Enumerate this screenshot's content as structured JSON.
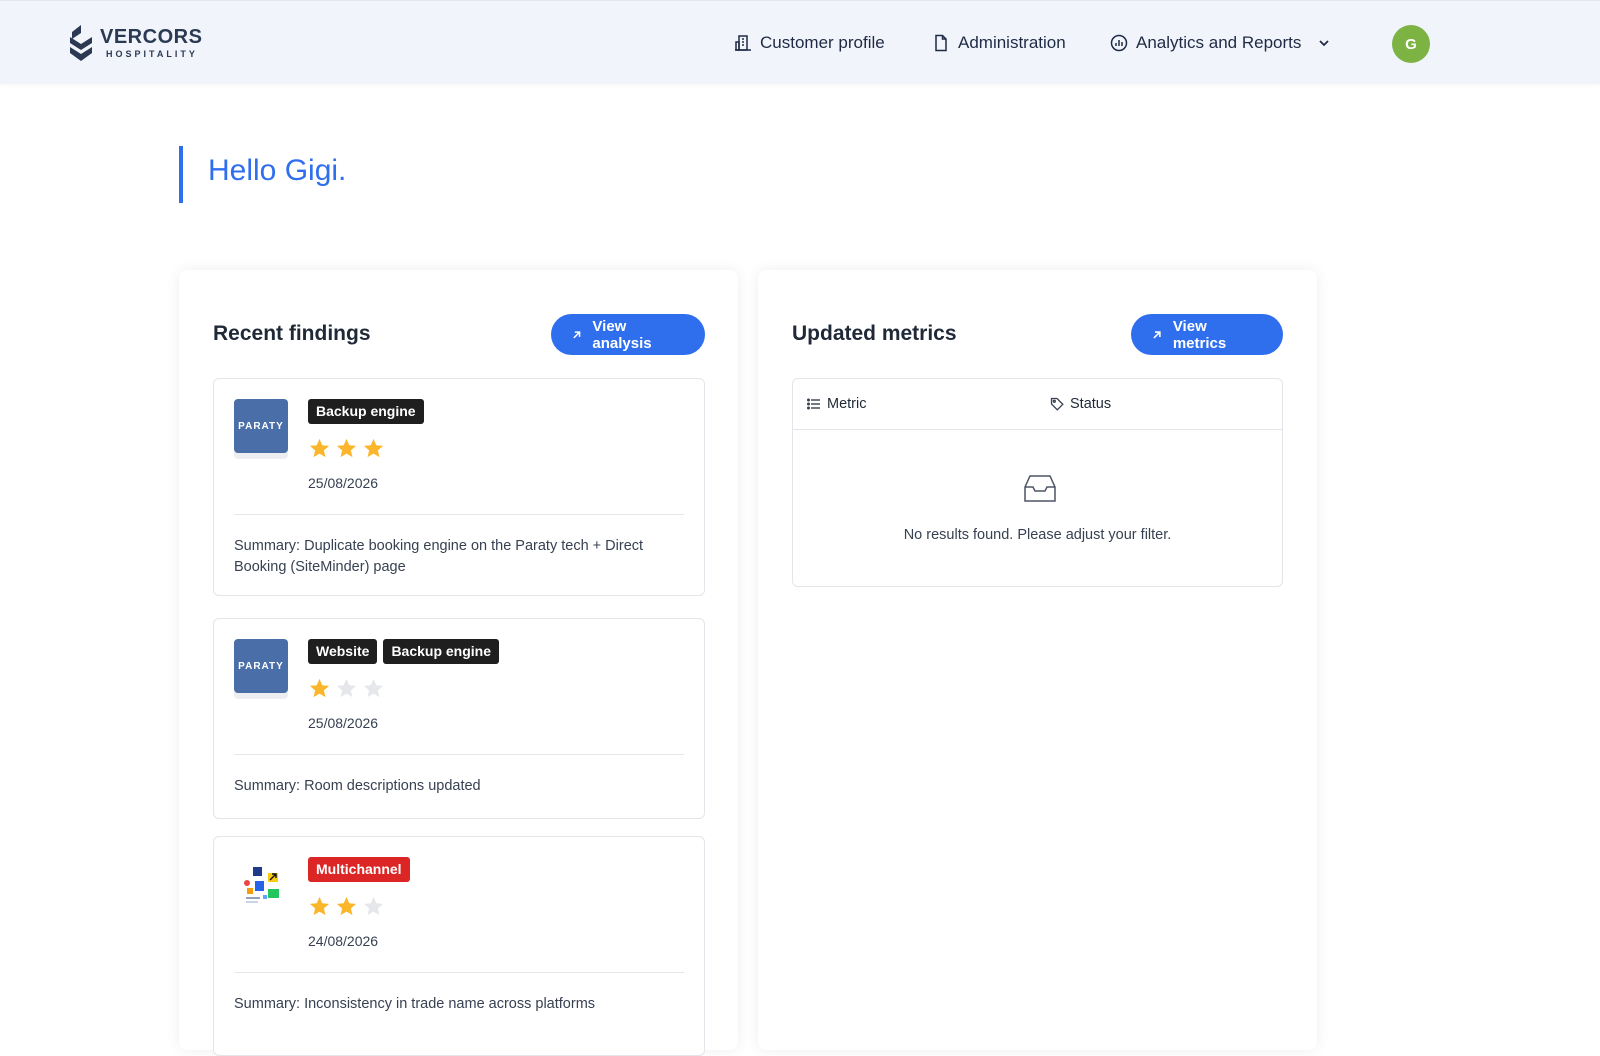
{
  "header": {
    "logo_title": "VERCORS",
    "logo_subtitle": "HOSPITALITY",
    "nav": {
      "customer_profile": "Customer profile",
      "administration": "Administration",
      "analytics": "Analytics and Reports"
    },
    "avatar_initial": "G"
  },
  "greeting": "Hello Gigi.",
  "findings": {
    "title": "Recent findings",
    "button_label": "View analysis",
    "items": [
      {
        "source_icon": "paraty-logo",
        "thumb_text": "PARATY",
        "tags": [
          "Backup engine"
        ],
        "rating": 3,
        "max_rating": 3,
        "date": "25/08/2026",
        "summary": "Summary: Duplicate booking engine on the Paraty tech + Direct Booking (SiteMinder) page"
      },
      {
        "source_icon": "paraty-logo",
        "thumb_text": "PARATY",
        "tags": [
          "Website",
          "Backup engine"
        ],
        "rating": 1,
        "max_rating": 3,
        "date": "25/08/2026",
        "summary": "Summary: Room descriptions updated"
      },
      {
        "source_icon": "multichannel-logo",
        "tags": [
          "Multichannel"
        ],
        "rating": 2,
        "max_rating": 3,
        "date": "24/08/2026",
        "summary": "Summary: Inconsistency in trade name across platforms"
      }
    ]
  },
  "metrics": {
    "title": "Updated metrics",
    "button_label": "View metrics",
    "columns": [
      "Metric",
      "Status"
    ],
    "empty_message": "No results found. Please adjust your filter."
  },
  "colors": {
    "accent": "#2f6fed",
    "header_bg": "#f1f5fb",
    "avatar_bg": "#7cb342",
    "tag_dark": "#1f1f1f",
    "tag_red": "#dc2626",
    "star_on": "#fbb62b",
    "star_off": "#e5e7eb"
  }
}
